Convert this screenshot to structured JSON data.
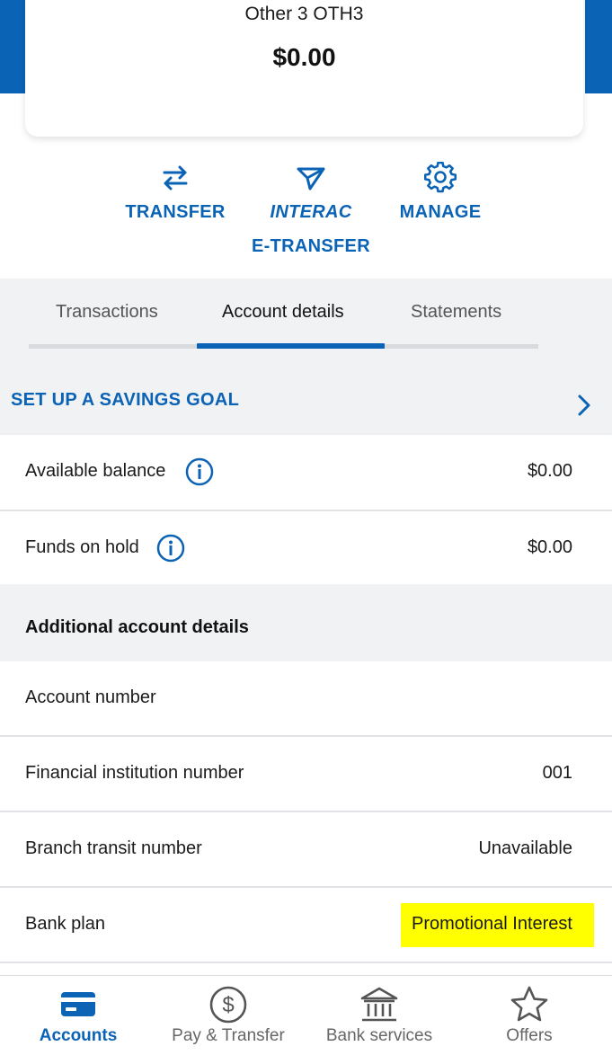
{
  "account": {
    "name": "Other 3 OTH3",
    "balance": "$0.00"
  },
  "actions": {
    "transfer": "TRANSFER",
    "etransfer_line1": "INTERAC",
    "etransfer_line2": "E-TRANSFER",
    "manage": "MANAGE"
  },
  "tabs": [
    {
      "label": "Transactions"
    },
    {
      "label": "Account details"
    },
    {
      "label": "Statements"
    }
  ],
  "active_tab": "Account details",
  "savings_goal": "SET UP A SAVINGS GOAL",
  "balances": {
    "available_label": "Available balance",
    "available_value": "$0.00",
    "hold_label": "Funds on hold",
    "hold_value": "$0.00"
  },
  "additional": {
    "title": "Additional account details",
    "rows": [
      {
        "label": "Account number",
        "value": ""
      },
      {
        "label": "Financial institution number",
        "value": "001"
      },
      {
        "label": "Branch transit number",
        "value": "Unavailable"
      },
      {
        "label": "Bank plan",
        "value": "Promotional Interest"
      }
    ]
  },
  "bottom_nav": [
    {
      "label": "Accounts",
      "icon": "card-icon"
    },
    {
      "label": "Pay & Transfer",
      "icon": "dollar-circle-icon"
    },
    {
      "label": "Bank services",
      "icon": "bank-icon"
    },
    {
      "label": "Offers",
      "icon": "star-icon"
    }
  ],
  "colors": {
    "brand": "#0b63b6",
    "highlight": "#ffff00"
  }
}
